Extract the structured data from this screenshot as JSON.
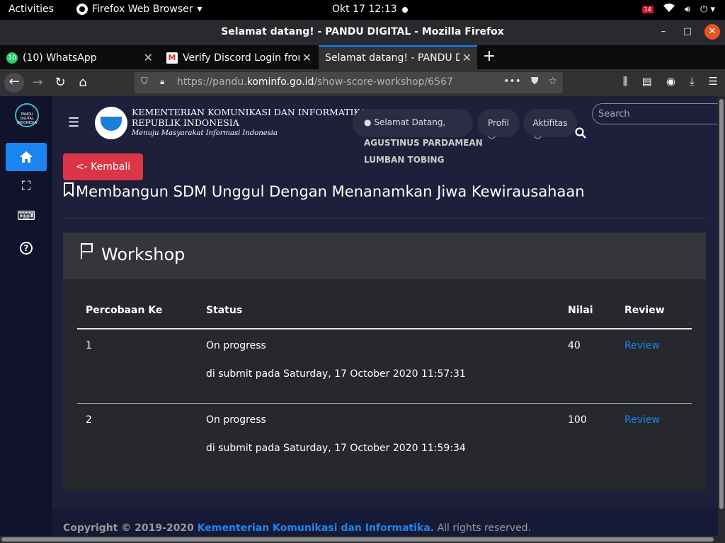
{
  "system": {
    "activities": "Activities",
    "app_name": "Firefox Web Browser",
    "clock": "Okt 17  12:13",
    "badge": "14"
  },
  "window": {
    "title": "Selamat datang! - PANDU DIGITAL - Mozilla Firefox"
  },
  "tabs": [
    {
      "label": "(10) WhatsApp",
      "icon": "whatsapp-icon",
      "badge": "10"
    },
    {
      "label": "Verify Discord Login from",
      "icon": "gmail-icon"
    },
    {
      "label": "Selamat datang! - PANDU DI",
      "icon": "page-icon"
    }
  ],
  "navbar": {
    "url_prefix": "https://pandu.",
    "url_domain": "kominfo.go.id",
    "url_path": "/show-score-workshop/6567"
  },
  "header": {
    "ministry_line1": "KEMENTERIAN KOMUNIKASI DAN INFORMATIKA",
    "ministry_line2": "REPUBLIK INDONESIA",
    "motto": "Menuju Masyarakat Informasi Indonesia",
    "welcome_label": "Selamat Datang,",
    "user_name_line1": "AGUSTINUS PARDAMEAN",
    "user_name_line2": "LUMBAN TOBING",
    "menu_profil": "Profil",
    "menu_aktifitas": "Aktifitas",
    "search_placeholder": "Search",
    "sidebar_logo_text": "PANDU DIGITAL INDONESIA"
  },
  "main": {
    "back_button": "<- Kembali",
    "page_title": "Membangun SDM Unggul Dengan Menanamkan Jiwa Kewirausahaan",
    "card_title": "Workshop",
    "table": {
      "headers": [
        "Percobaan Ke",
        "Status",
        "Nilai",
        "Review"
      ],
      "rows": [
        {
          "attempt": "1",
          "status": "On progress",
          "submitted": "di submit pada Saturday, 17 October 2020 11:57:31",
          "score": "40",
          "review": "Review"
        },
        {
          "attempt": "2",
          "status": "On progress",
          "submitted": "di submit pada Saturday, 17 October 2020 11:59:34",
          "score": "100",
          "review": "Review"
        }
      ]
    }
  },
  "footer": {
    "prefix": "Copyright © 2019-2020 ",
    "link": "Kementerian Komunikasi dan Informatika.",
    "suffix": " All rights reserved."
  },
  "colors": {
    "accent": "#1a85f0",
    "danger": "#dc3545",
    "page_bg": "#1e1f3a"
  }
}
